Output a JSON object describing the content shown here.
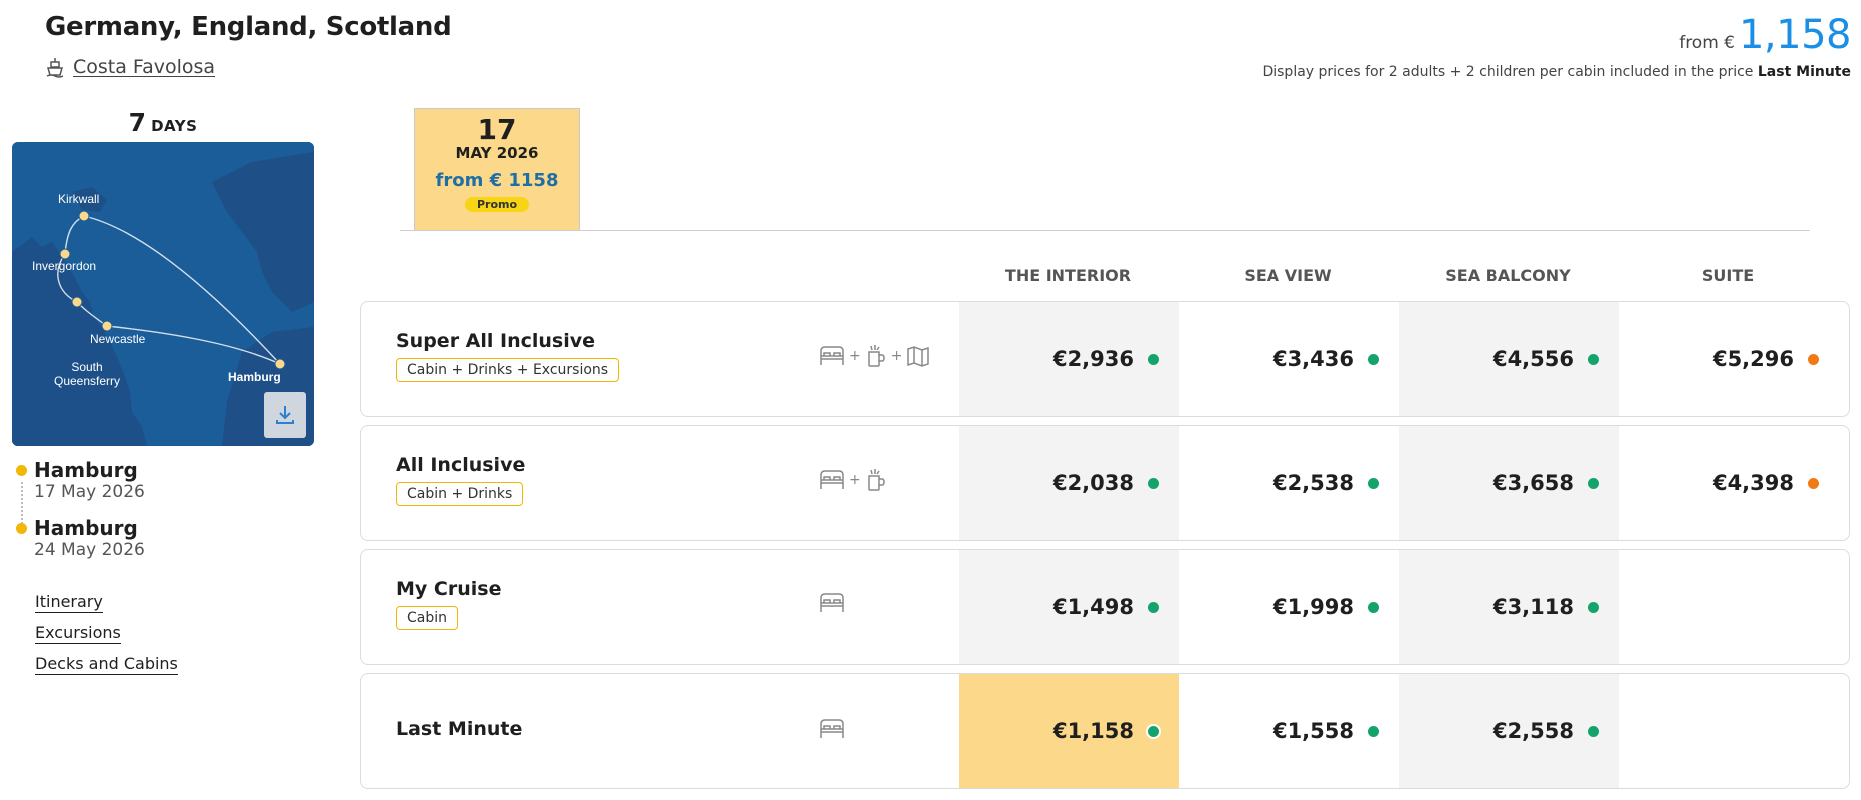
{
  "header": {
    "title": "Germany, England, Scotland",
    "ship_name": "Costa Favolosa",
    "from_label": "from €",
    "from_price": "1,158",
    "display_note_prefix": "Display prices for 2 adults + 2 children per cabin included in the price",
    "display_note_fare": "Last Minute"
  },
  "duration": {
    "number": "7",
    "label": "DAYS"
  },
  "map": {
    "ports": [
      "Kirkwall",
      "Invergordon",
      "Newcastle",
      "South Queensferry",
      "Hamburg"
    ],
    "sea_color": "#1a5d99",
    "land_color": "#1e4f86",
    "download_icon": "download-icon"
  },
  "itinerary": [
    {
      "port": "Hamburg",
      "date": "17 May 2026"
    },
    {
      "port": "Hamburg",
      "date": "24 May 2026"
    }
  ],
  "links": [
    "Itinerary",
    "Excursions",
    "Decks and Cabins"
  ],
  "date_card": {
    "day": "17",
    "month": "MAY 2026",
    "from_price": "from € 1158",
    "badge": "Promo"
  },
  "columns": [
    "THE INTERIOR",
    "SEA VIEW",
    "SEA BALCONY",
    "SUITE"
  ],
  "fares": [
    {
      "name": "Super All Inclusive",
      "badge": "Cabin + Drinks + Excursions",
      "icons": [
        "bed-icon",
        "drink-icon",
        "map-icon"
      ],
      "prices": [
        {
          "value": "€2,936",
          "availability": "green"
        },
        {
          "value": "€3,436",
          "availability": "green"
        },
        {
          "value": "€4,556",
          "availability": "green"
        },
        {
          "value": "€5,296",
          "availability": "orange"
        }
      ]
    },
    {
      "name": "All Inclusive",
      "badge": "Cabin + Drinks",
      "icons": [
        "bed-icon",
        "drink-icon"
      ],
      "prices": [
        {
          "value": "€2,038",
          "availability": "green"
        },
        {
          "value": "€2,538",
          "availability": "green"
        },
        {
          "value": "€3,658",
          "availability": "green"
        },
        {
          "value": "€4,398",
          "availability": "orange"
        }
      ]
    },
    {
      "name": "My Cruise",
      "badge": "Cabin",
      "icons": [
        "bed-icon"
      ],
      "prices": [
        {
          "value": "€1,498",
          "availability": "green"
        },
        {
          "value": "€1,998",
          "availability": "green"
        },
        {
          "value": "€3,118",
          "availability": "green"
        },
        null
      ]
    },
    {
      "name": "Last Minute",
      "badge": "",
      "icons": [
        "bed-icon"
      ],
      "prices": [
        {
          "value": "€1,158",
          "availability": "green",
          "selected": true
        },
        {
          "value": "€1,558",
          "availability": "green"
        },
        {
          "value": "€2,558",
          "availability": "green"
        },
        null
      ]
    }
  ],
  "plus_sign": "+",
  "colors": {
    "accent_blue": "#1b8fe6",
    "highlight_gold": "#fcd98a",
    "available_green": "#13a36b",
    "limited_orange": "#f07b16",
    "promo_yellow": "#f7d515"
  }
}
